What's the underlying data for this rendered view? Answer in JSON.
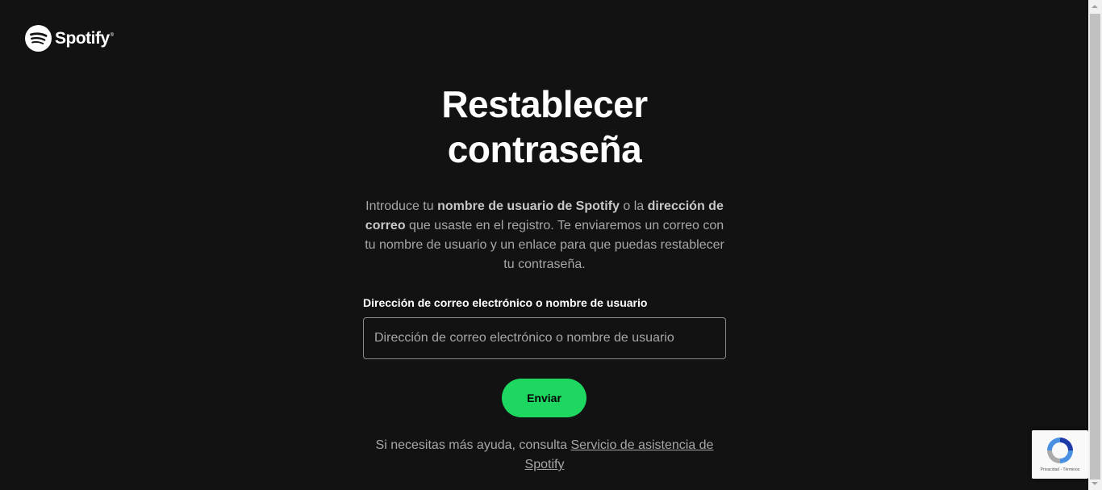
{
  "brand": {
    "name": "Spotify",
    "trademark": "®",
    "accent_color": "#1ed760",
    "background_color": "#121212"
  },
  "main": {
    "title": "Restablecer contraseña",
    "intro": {
      "part1": "Introduce tu ",
      "bold1": "nombre de usuario de Spotify",
      "part2": " o la ",
      "bold2": "dirección de correo",
      "part3": " que usaste en el registro. Te enviaremos un correo con tu nombre de usuario y un enlace para que puedas restablecer tu contraseña."
    },
    "field": {
      "label": "Dirección de correo electrónico o nombre de usuario",
      "placeholder": "Dirección de correo electrónico o nombre de usuario",
      "value": ""
    },
    "submit_label": "Enviar",
    "help": {
      "text": "Si necesitas más ayuda, consulta ",
      "link_text": "Servicio de asistencia de Spotify"
    }
  },
  "recaptcha": {
    "icon": "recaptcha-icon",
    "privacy": "Privacidad",
    "separator": " - ",
    "terms": "Términos"
  }
}
